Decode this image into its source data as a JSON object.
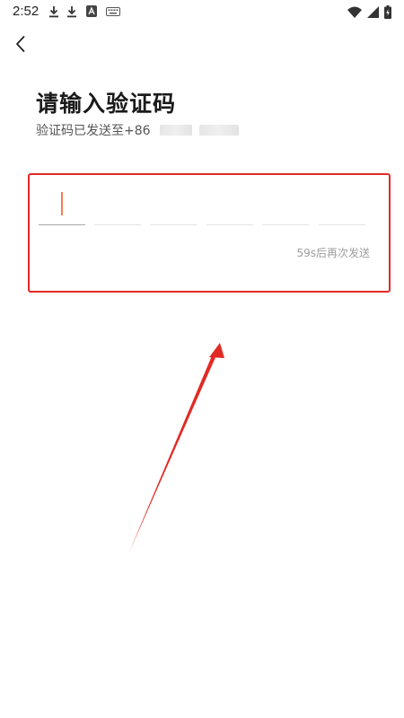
{
  "status_bar": {
    "time": "2:52",
    "icons": [
      "download-icon",
      "download-icon",
      "app-store-icon",
      "keyboard-icon",
      "wifi-icon",
      "signal-icon",
      "battery-charging-icon"
    ]
  },
  "header": {
    "back_icon": "chevron-left-icon"
  },
  "main": {
    "title": "请输入验证码",
    "subtitle_prefix": "验证码已发送至+86",
    "code_length": 6,
    "resend_text": "59s后再次发送"
  },
  "colors": {
    "highlight": "#e22a25",
    "cursor": "#f07f55",
    "arrow": "#e22a25"
  }
}
